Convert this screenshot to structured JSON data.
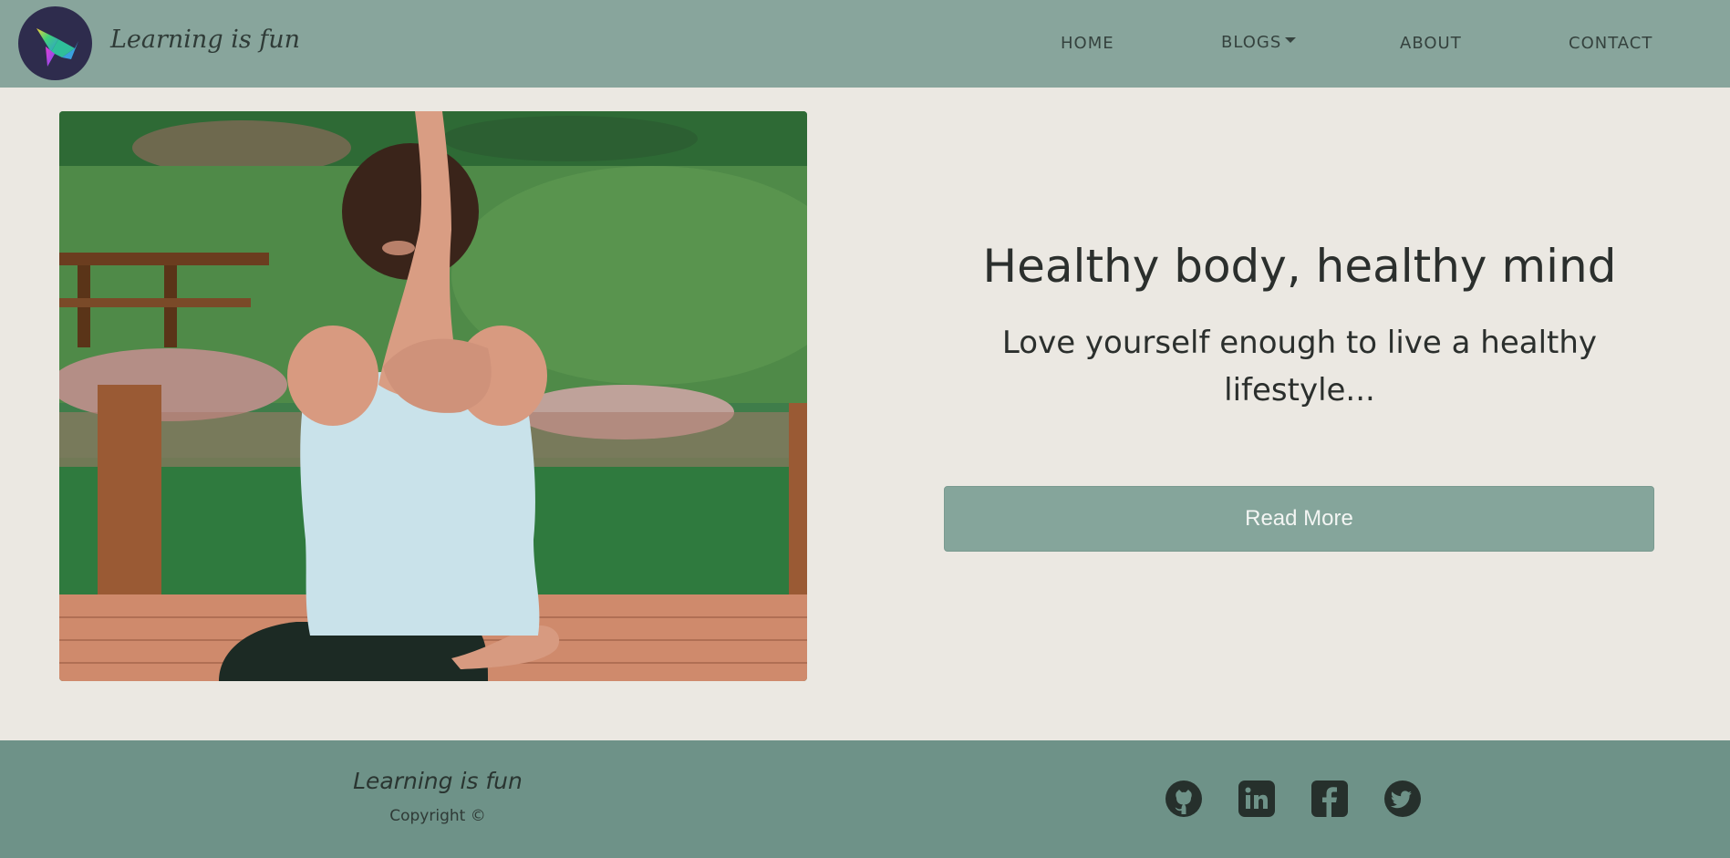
{
  "nav": {
    "brand": "Learning is fun",
    "logo_icon": "bird-origami-icon",
    "links": [
      {
        "label": "HOME"
      },
      {
        "label": "BLOGS",
        "has_dropdown": true
      },
      {
        "label": "ABOUT"
      },
      {
        "label": "CONTACT"
      }
    ]
  },
  "hero": {
    "image_subject": "woman doing yoga eagle arms pose outdoors",
    "title": "Healthy body, healthy mind",
    "subtitle": "Love yourself enough to live a healthy lifestyle...",
    "button_label": "Read More"
  },
  "footer": {
    "brand": "Learning is fun",
    "copyright": "Copyright ©",
    "social": [
      {
        "name": "github-icon"
      },
      {
        "name": "linkedin-icon"
      },
      {
        "name": "facebook-icon"
      },
      {
        "name": "twitter-icon"
      }
    ]
  },
  "colors": {
    "navbar": "#88a59c",
    "body": "#ebe8e2",
    "button": "#85a59b",
    "footer": "#6e9288",
    "text": "#2b2f2d"
  }
}
